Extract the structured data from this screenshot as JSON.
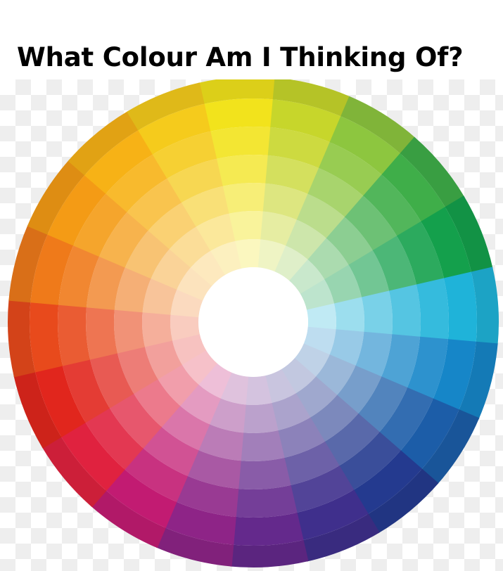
{
  "page": {
    "title": "What Colour Am I Thinking Of?"
  },
  "wheel": {
    "icon": "colour-wheel",
    "hues": [
      {
        "name": "yellow",
        "color": "#f2e31c"
      },
      {
        "name": "yellow-green",
        "color": "#c7d62b"
      },
      {
        "name": "light-green",
        "color": "#8dc63f"
      },
      {
        "name": "green",
        "color": "#3fae49"
      },
      {
        "name": "emerald",
        "color": "#14a04c"
      },
      {
        "name": "cyan",
        "color": "#1fb3d9"
      },
      {
        "name": "azure",
        "color": "#1686c8"
      },
      {
        "name": "blue",
        "color": "#1c5da8"
      },
      {
        "name": "navy",
        "color": "#243a8f"
      },
      {
        "name": "indigo",
        "color": "#3f2f8c"
      },
      {
        "name": "violet",
        "color": "#64298c"
      },
      {
        "name": "purple",
        "color": "#8e2487"
      },
      {
        "name": "magenta",
        "color": "#c21b72"
      },
      {
        "name": "crimson",
        "color": "#e0223f"
      },
      {
        "name": "red",
        "color": "#e1261d"
      },
      {
        "name": "red-orange",
        "color": "#e84a1c"
      },
      {
        "name": "orange",
        "color": "#ef7a1a"
      },
      {
        "name": "orange-yellow",
        "color": "#f49b15"
      },
      {
        "name": "amber",
        "color": "#f7b216"
      },
      {
        "name": "golden-yellow",
        "color": "#f5cb1c"
      }
    ]
  }
}
